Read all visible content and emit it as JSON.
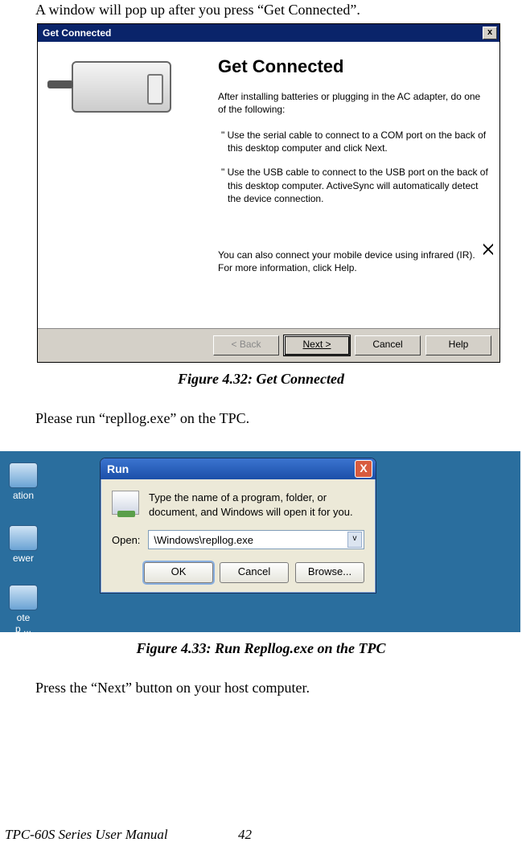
{
  "intro_text": "A window will pop up after you press “Get Connected”.",
  "gc": {
    "titlebar": "Get Connected",
    "heading": "Get Connected",
    "p1": "After installing batteries or plugging in the AC adapter, do one of the following:",
    "b1": "\" Use the serial cable to connect to a COM port on the back of this desktop computer and click Next.",
    "b2": "\" Use the USB cable to connect to the USB port on the back of this desktop computer.   ActiveSync will automatically detect the device connection.",
    "p2a": "You can also connect your mobile device using infrared (IR).",
    "p2b": "For more information, click Help.",
    "btn_back": "< Back",
    "btn_next": "Next >",
    "btn_cancel": "Cancel",
    "btn_help": "Help"
  },
  "caption1": "Figure 4.32: Get Connected",
  "mid_text": "Please run “repllog.exe” on the TPC.",
  "desktop": {
    "icon1": "ation",
    "icon2": "ewer",
    "icon3a": "ote",
    "icon3b": "p ..."
  },
  "run": {
    "title": "Run",
    "desc": "Type the name of a program, folder, or document, and Windows will open it for you.",
    "open_label": "Open:",
    "value": "\\Windows\\repllog.exe",
    "ok": "OK",
    "cancel": "Cancel",
    "browse": "Browse..."
  },
  "caption2": "Figure 4.33: Run Repllog.exe on the TPC",
  "after_text": "Press the “Next” button on your host computer.",
  "footer_manual": "TPC-60S Series User Manual",
  "footer_page": "42"
}
